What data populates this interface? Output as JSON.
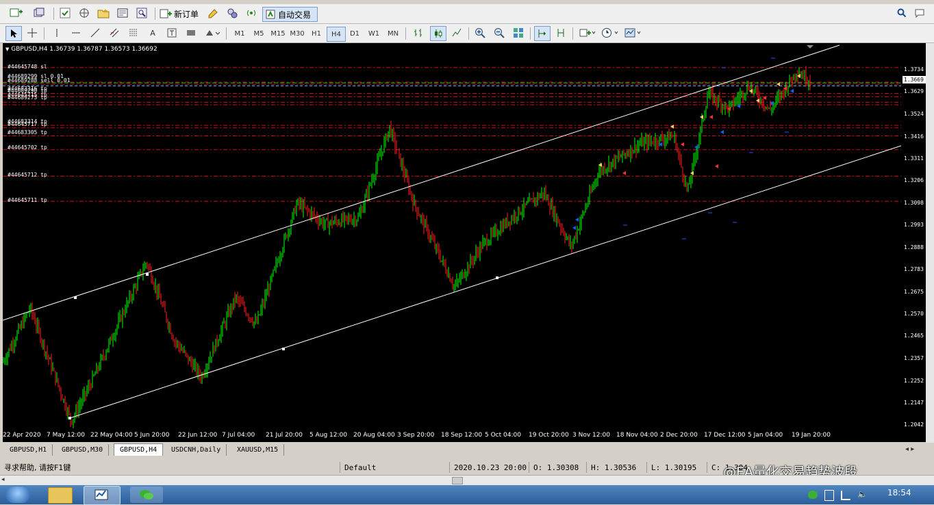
{
  "toolbar1": {
    "new_order_label": "新订单",
    "auto_trade_label": "自动交易"
  },
  "toolbar2": {
    "timeframes": [
      "M1",
      "M5",
      "M15",
      "M30",
      "H1",
      "H4",
      "D1",
      "W1",
      "MN"
    ],
    "active_timeframe": "H4"
  },
  "chart": {
    "header": "GBPUSD,H4  1.36739 1.36787 1.36573 1.36692",
    "current_price": "1.3669",
    "price_ticks": [
      "1.3734",
      "1.3629",
      "1.3524",
      "1.3416",
      "1.3311",
      "1.3206",
      "1.3098",
      "1.2993",
      "1.2888",
      "1.2783",
      "1.2675",
      "1.2570",
      "1.2465",
      "1.2357",
      "1.2252",
      "1.2147",
      "1.2042"
    ],
    "time_ticks": [
      "22 Apr 2020",
      "7 May 12:00",
      "22 May 04:00",
      "5 Jun 20:00",
      "22 Jun 12:00",
      "7 Jul 04:00",
      "21 Jul 20:00",
      "5 Aug 12:00",
      "20 Aug 04:00",
      "3 Sep 20:00",
      "18 Sep 12:00",
      "5 Oct 04:00",
      "19 Oct 20:00",
      "3 Nov 12:00",
      "18 Nov 04:00",
      "2 Dec 20:00",
      "17 Dec 12:00",
      "5 Jan 04:00",
      "19 Jan 20:00"
    ],
    "order_labels": [
      "#44645748 sl",
      "#44689299 sl  0.01",
      "#44689288 sell 0.01",
      "#44683316 tp",
      "#44689290 tp",
      "#44645715 tp",
      "#44689273 tp",
      "#44683314 tp",
      "#44645717 tp",
      "#44683305 tp",
      "#44645702 tp",
      "#44645712 tp",
      "#44645711 tp"
    ]
  },
  "tabs": [
    "GBPUSD,H1",
    "GBPUSD,M30",
    "GBPUSD,H4",
    "USDCNH,Daily",
    "XAUUSD,M15"
  ],
  "active_tab": "GBPUSD,H4",
  "status": {
    "help": "寻求帮助, 请按F1键",
    "profile": "Default",
    "datetime": "2020.10.23 20:00",
    "open": "O: 1.30308",
    "high": "H: 1.30536",
    "low": "L: 1.30195",
    "close": "C: 1.304",
    "watermark": "@EA量化交易趋势波段"
  },
  "taskbar": {
    "time": "18:54"
  },
  "colors": {
    "bull": "#00ff00",
    "bear": "#ff2020",
    "order_line": "#cc0000",
    "tp_line": "#00c000",
    "channel": "#ffffff"
  }
}
